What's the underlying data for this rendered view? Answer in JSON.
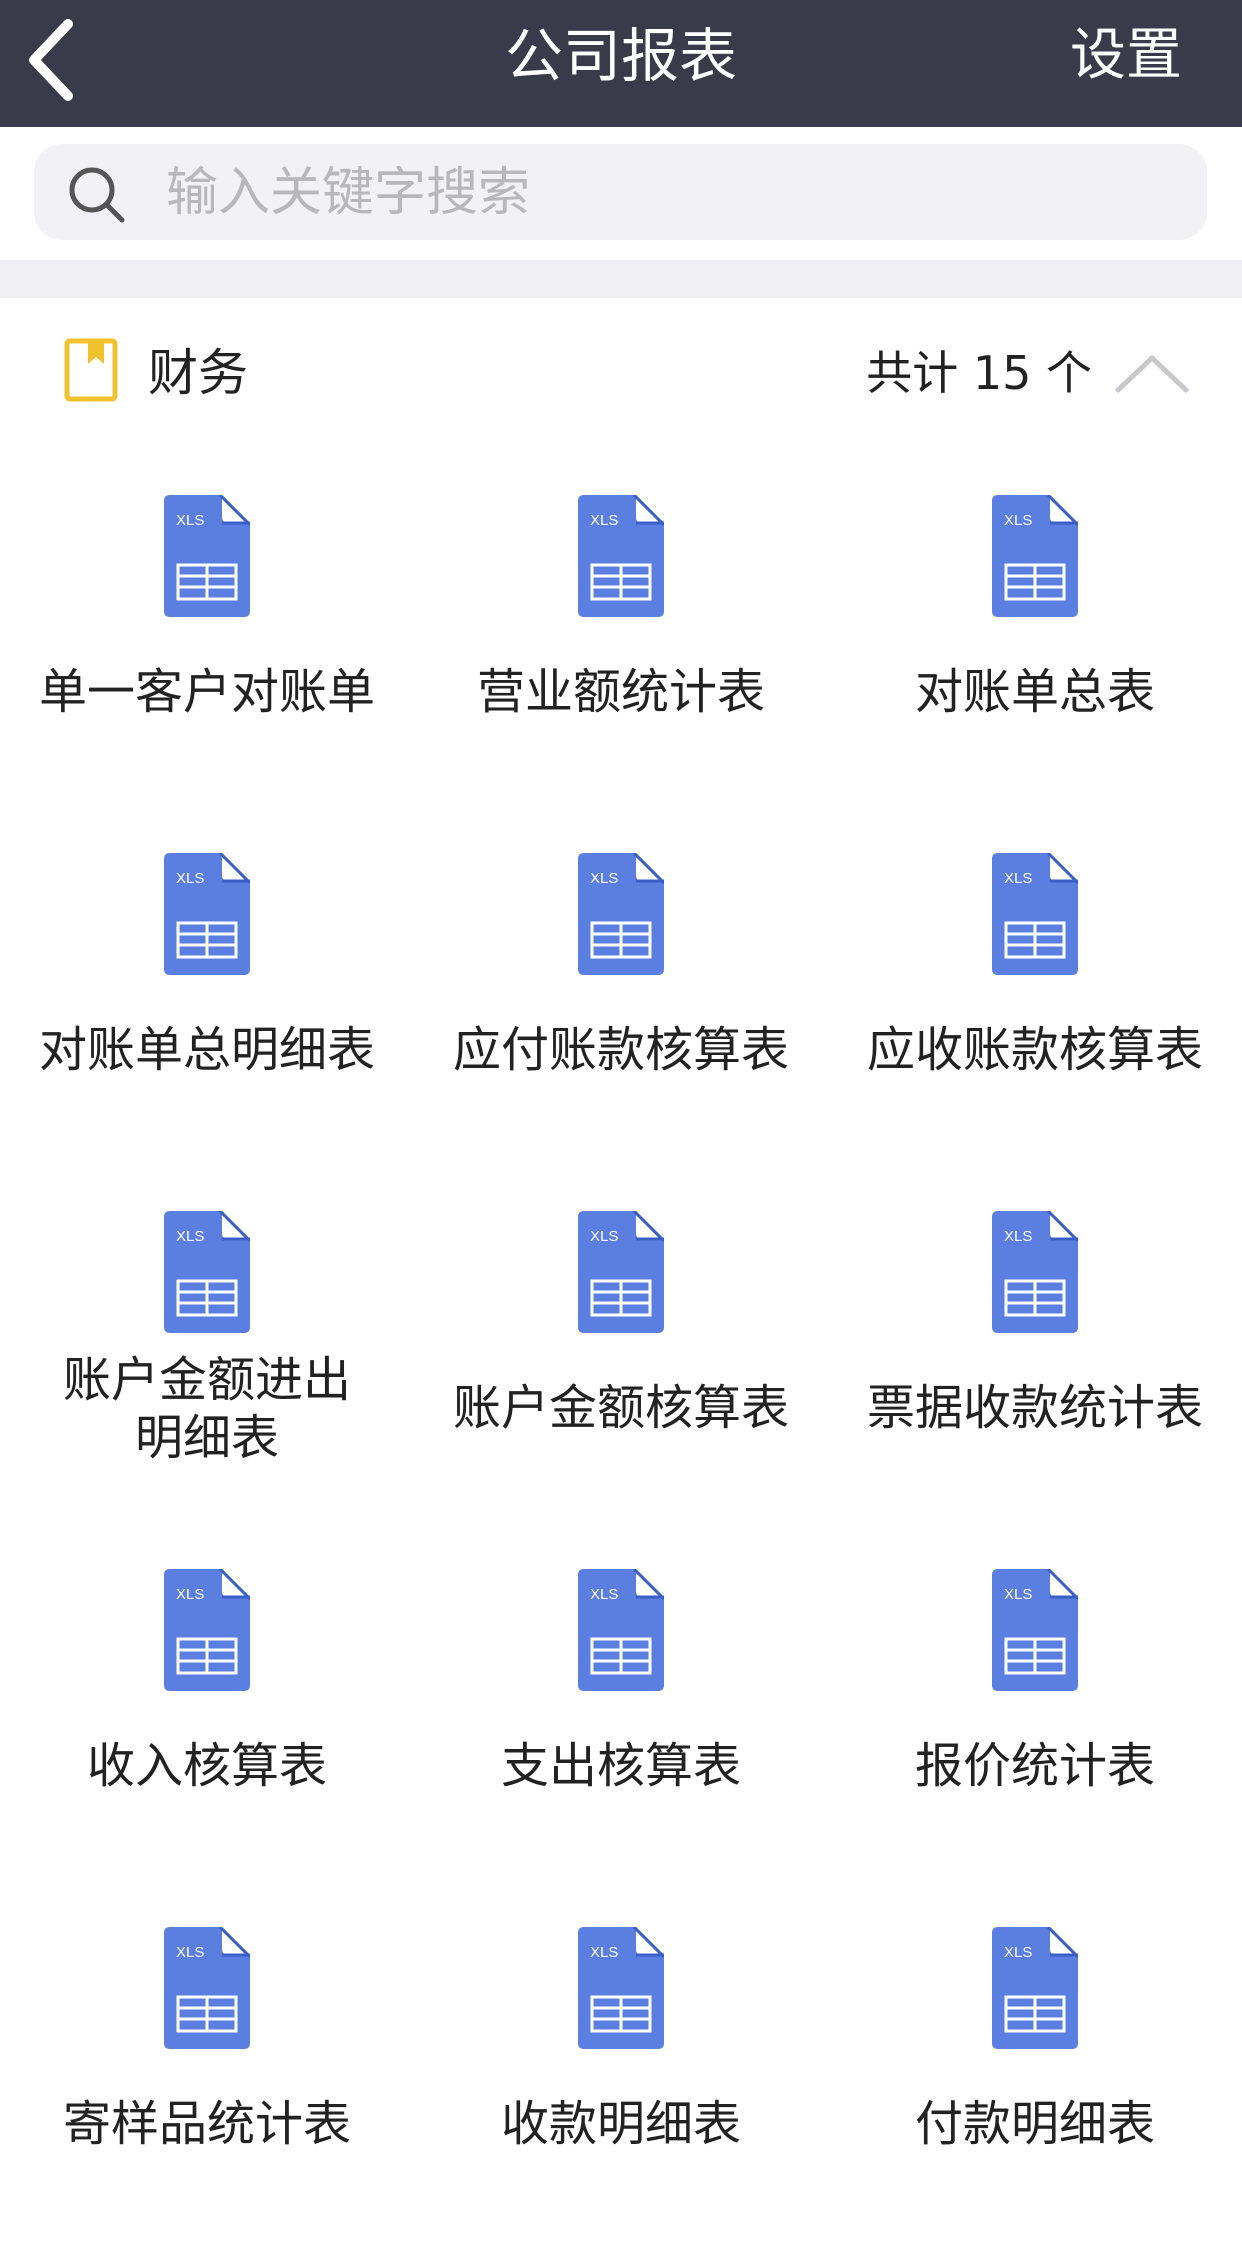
{
  "header": {
    "title": "公司报表",
    "settings_label": "设置"
  },
  "search": {
    "placeholder": "输入关键字搜索"
  },
  "section": {
    "title": "财务",
    "count_text": "共计 15 个"
  },
  "colors": {
    "header_bg": "#3a3a4a",
    "icon_blue": "#5b7fe0",
    "folder_yellow": "#f2c12e"
  },
  "reports": [
    {
      "label": "单一客户对账单"
    },
    {
      "label": "营业额统计表"
    },
    {
      "label": "对账单总表"
    },
    {
      "label": "对账单总明细表"
    },
    {
      "label": "应付账款核算表"
    },
    {
      "label": "应收账款核算表"
    },
    {
      "label": "账户金额进出\n明细表"
    },
    {
      "label": "账户金额核算表"
    },
    {
      "label": "票据收款统计表"
    },
    {
      "label": "收入核算表"
    },
    {
      "label": "支出核算表"
    },
    {
      "label": "报价统计表"
    },
    {
      "label": "寄样品统计表"
    },
    {
      "label": "收款明细表"
    },
    {
      "label": "付款明细表"
    }
  ],
  "icon_badge": "XLS"
}
